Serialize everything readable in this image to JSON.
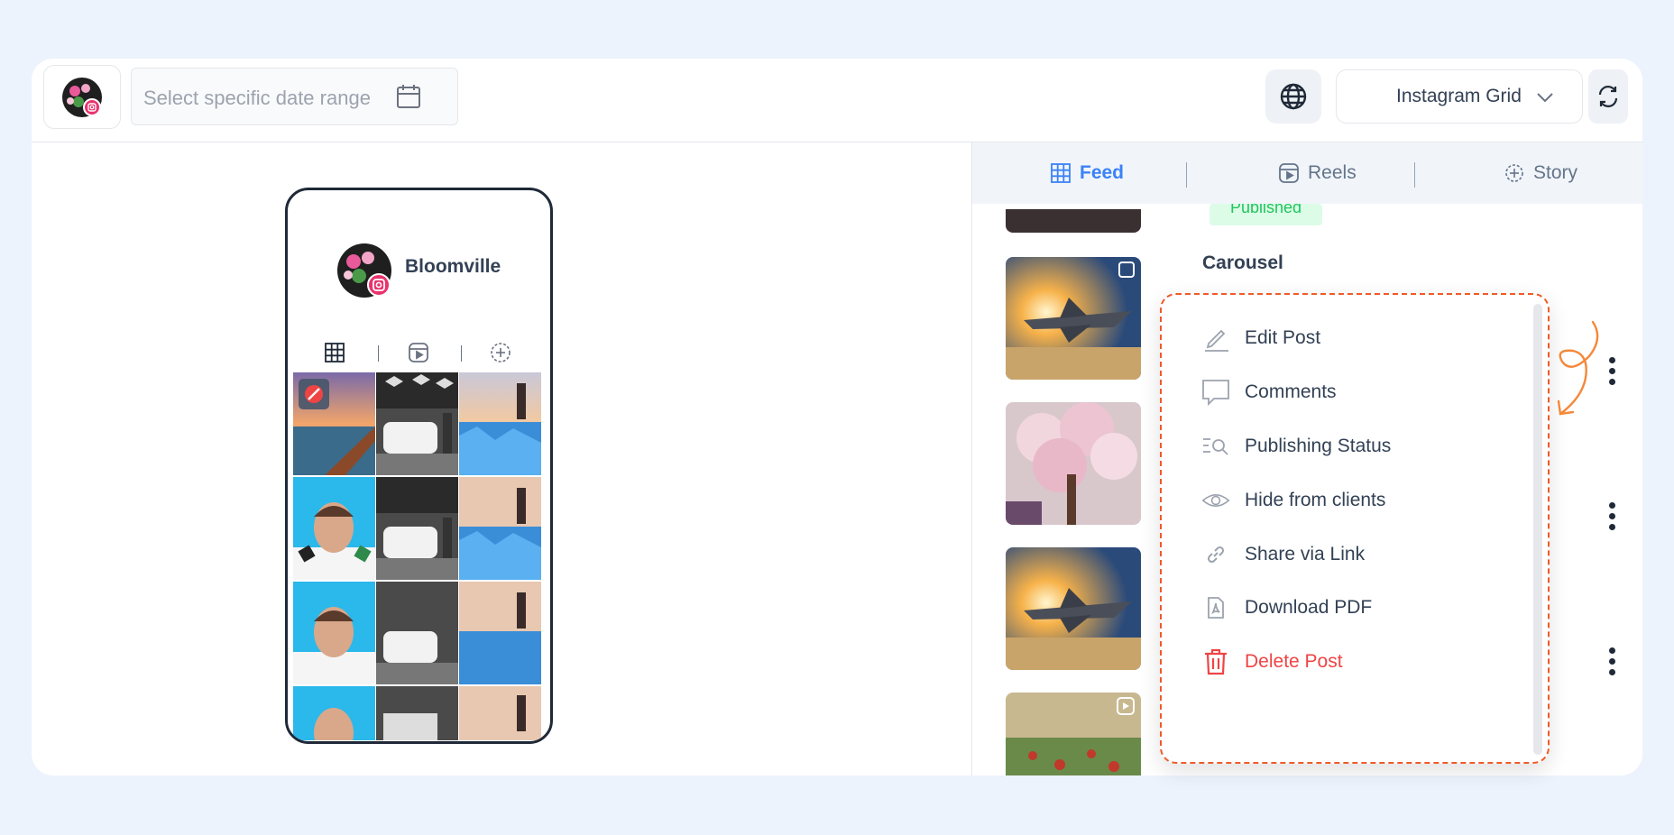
{
  "topbar": {
    "date_placeholder": "Select specific date range",
    "view_selected": "Instagram Grid"
  },
  "preview": {
    "profile_name": "Bloomville"
  },
  "right_tabs": [
    {
      "label": "Feed",
      "active": true,
      "icon": "grid-icon"
    },
    {
      "label": "Reels",
      "active": false,
      "icon": "reels-icon"
    },
    {
      "label": "Story",
      "active": false,
      "icon": "story-icon"
    }
  ],
  "posts": {
    "carousel_label": "Carousel",
    "status_badge": "Published"
  },
  "menu": {
    "items": [
      {
        "label": "Edit Post",
        "icon": "pencil-icon"
      },
      {
        "label": "Comments",
        "icon": "comment-icon"
      },
      {
        "label": "Publishing Status",
        "icon": "status-search-icon"
      },
      {
        "label": "Hide from clients",
        "icon": "eye-icon"
      },
      {
        "label": "Share via Link",
        "icon": "link-icon"
      },
      {
        "label": "Download PDF",
        "icon": "pdf-icon"
      },
      {
        "label": "Delete Post",
        "icon": "trash-icon"
      }
    ]
  },
  "colors": {
    "accent": "#3b82f6",
    "danger": "#ef4444",
    "highlight_border": "#f05a28",
    "page_bg": "#edf3fc"
  }
}
